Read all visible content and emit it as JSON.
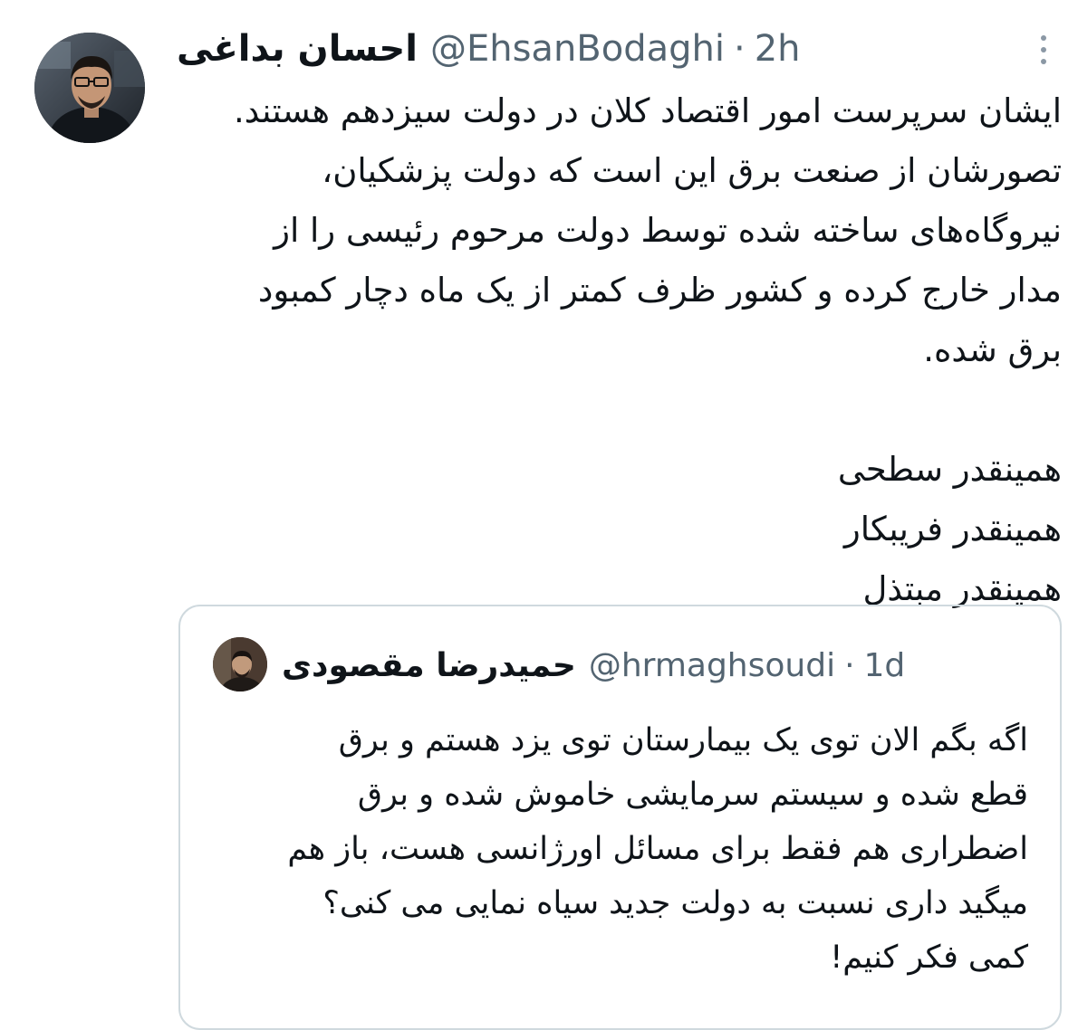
{
  "tweet": {
    "display_name": "احسان بداغی",
    "handle": "@EhsanBodaghi",
    "separator": "·",
    "time": "2h",
    "body": "ایشان سرپرست امور اقتصاد کلان در دولت سیزدهم هستند.\nتصورشان از صنعت برق این است که دولت پزشکیان،\nنیروگاه‌های ساخته شده توسط دولت مرحوم رئیسی را از\nمدار خارج کرده و کشور ظرف کمتر از یک ماه دچار کمبود\nبرق شده.\n\nهمینقدر سطحی\nهمینقدر فریبکار\nهمینقدر مبتذل",
    "more_icon": "more-vertical-icon"
  },
  "quoted_tweet": {
    "display_name": "حمیدرضا مقصودی",
    "handle": "@hrmaghsoudi",
    "separator": "·",
    "time": "1d",
    "body": "اگه بگم الان توی یک بیمارستان توی یزد هستم و برق\nقطع شده و سیستم سرمایشی خاموش شده و برق\nاضطراری هم فقط برای مسائل اورژانسی هست، باز هم\nمیگید داری نسبت به دولت جدید سیاه نمایی می کنی؟\nکمی فکر کنیم!"
  },
  "colors": {
    "text_primary": "#0f1419",
    "text_secondary": "#536471",
    "border": "#cfd9de",
    "background": "#ffffff"
  }
}
